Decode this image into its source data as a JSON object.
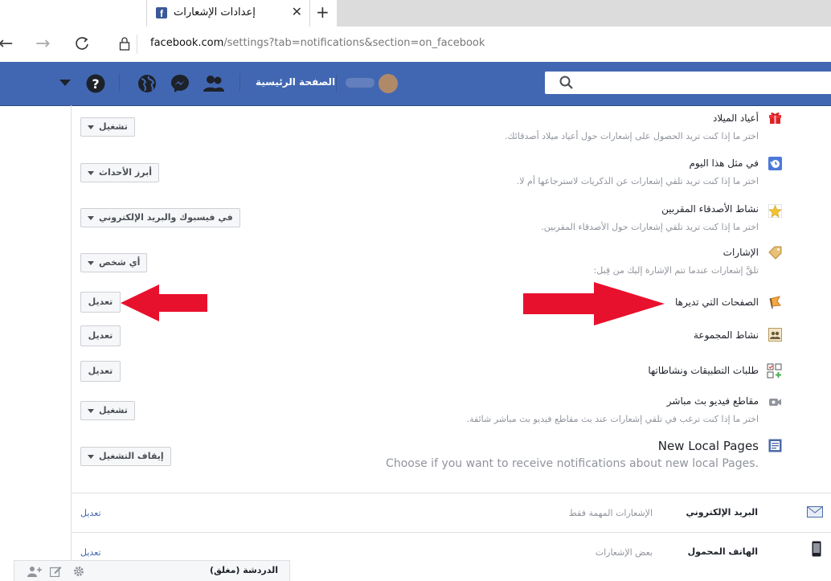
{
  "browser": {
    "tab_title": "إعدادات الإشعارات",
    "url_host": "facebook.com",
    "url_rest": "/settings?tab=notifications&section=on_facebook"
  },
  "topbar": {
    "home_label": "الصفحة الرئيسية",
    "icons": [
      "search-icon",
      "friends-icon",
      "messenger-icon",
      "globe-icon",
      "help-icon",
      "caret-icon"
    ],
    "brand_color": "#4267b2"
  },
  "settings_rows": [
    {
      "title": "أعياد الميلاد",
      "desc": "اختر ما إذا كنت تريد الحصول على إشعارات حول أعياد ميلاد أصدقائك.",
      "control": "تشغيل",
      "icon": "gift-icon"
    },
    {
      "title": "في مثل هذا اليوم",
      "desc": "اختر ما إذا كنت تريد تلقي إشعارات عن الذكريات لاسترجاعها أم لا.",
      "control": "أبرز الأحداث",
      "icon": "memories-clock-icon"
    },
    {
      "title": "نشاط الأصدقاء المقربين",
      "desc": "اختر ما إذا كنت تريد تلقي إشعارات حول الأصدقاء المقربين.",
      "control": "في فيسبوك والبريد الإلكتروني",
      "icon": "star-icon"
    },
    {
      "title": "الإشارات",
      "desc": "تلقَّ إشعارات عندما تتم الإشارة إليك من قِبل:",
      "control": "أي شخص",
      "icon": "tag-icon"
    },
    {
      "title": "الصفحات التي تديرها",
      "desc": "",
      "control": "تعديل",
      "icon": "flag-icon"
    },
    {
      "title": "نشاط المجموعة",
      "desc": "",
      "control": "تعديل",
      "icon": "group-icon"
    },
    {
      "title": "طلبات التطبيقات ونشاطاتها",
      "desc": "",
      "control": "تعديل",
      "icon": "apps-icon"
    },
    {
      "title": "مقاطع فيديو بث مباشر",
      "desc": "اختر ما إذا كنت ترغب في تلقي إشعارات عند بث مقاطع فيديو بث مباشر شائقة.",
      "control": "تشغيل",
      "icon": "video-camera-icon"
    },
    {
      "title": "New Local Pages",
      "desc": "Choose if you want to receive notifications about new local Pages.",
      "control": "إيقاف التشغيل",
      "icon": "local-pages-icon"
    }
  ],
  "other_channels": [
    {
      "label": "البريد الإلكتروني",
      "value": "الإشعارات المهمة فقط",
      "link": "تعديل",
      "icon": "envelope-icon"
    },
    {
      "label": "الهاتف المحمول",
      "value": "بعض الإشعارات",
      "link": "تعديل",
      "icon": "mobile-phone-icon"
    }
  ],
  "chat": {
    "label": "الدردشة (مغلق)"
  },
  "annotation_color": "#e8112d"
}
